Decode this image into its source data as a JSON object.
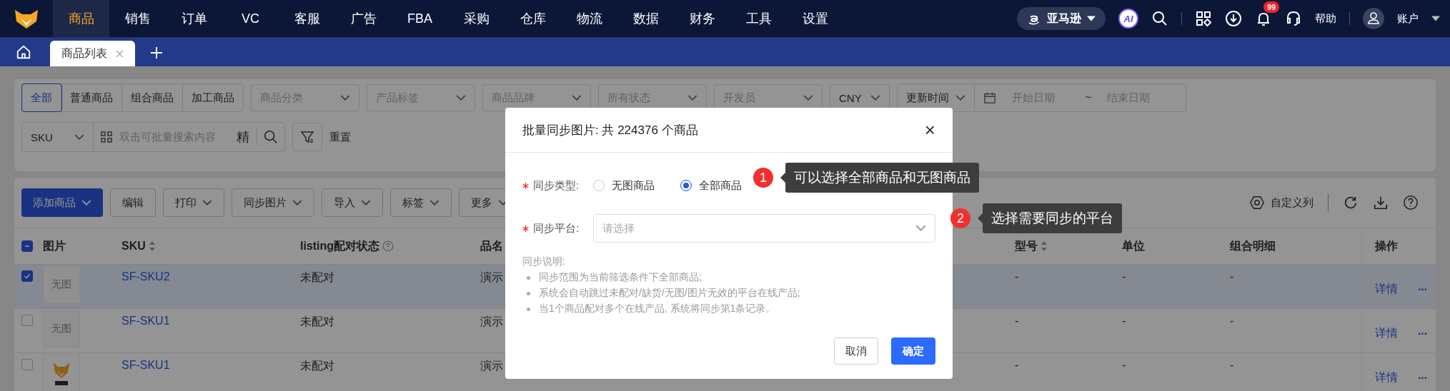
{
  "nav": {
    "items": [
      {
        "label": "商品",
        "selected": true
      },
      {
        "label": "销售",
        "selected": false
      },
      {
        "label": "订单",
        "selected": false
      },
      {
        "label": "VC",
        "selected": false
      },
      {
        "label": "客服",
        "selected": false
      },
      {
        "label": "广告",
        "selected": false
      },
      {
        "label": "FBA",
        "selected": false
      },
      {
        "label": "采购",
        "selected": false
      },
      {
        "label": "仓库",
        "selected": false
      },
      {
        "label": "物流",
        "selected": false
      },
      {
        "label": "数据",
        "selected": false
      },
      {
        "label": "财务",
        "selected": false
      },
      {
        "label": "工具",
        "selected": false
      },
      {
        "label": "设置",
        "selected": false
      }
    ],
    "platform": "亚马逊",
    "ai": "AI",
    "notifications": "99",
    "help": "帮助",
    "account": "账户"
  },
  "tabs": [
    {
      "label": "商品列表",
      "selected": true
    }
  ],
  "filters": {
    "segments": [
      {
        "label": "全部",
        "selected": true
      },
      {
        "label": "普通商品",
        "selected": false
      },
      {
        "label": "组合商品",
        "selected": false
      },
      {
        "label": "加工商品",
        "selected": false
      }
    ],
    "selects": [
      {
        "placeholder": "商品分类"
      },
      {
        "placeholder": "产品标签"
      },
      {
        "placeholder": "商品品牌"
      },
      {
        "placeholder": "所有状态"
      },
      {
        "placeholder": "开发员"
      }
    ],
    "currency": "CNY",
    "date_field": "更新时间",
    "start_placeholder": "开始日期",
    "range_sep": "~",
    "end_placeholder": "结束日期",
    "search_field": "SKU",
    "search_placeholder": "双击可批量搜索内容",
    "exact": "精",
    "reset": "重置"
  },
  "toolbar": {
    "buttons": [
      {
        "label": "添加商品",
        "kind": "primary",
        "dropdown": true
      },
      {
        "label": "编辑",
        "kind": "plain",
        "dropdown": false
      },
      {
        "label": "打印",
        "kind": "plain",
        "dropdown": true
      },
      {
        "label": "同步图片",
        "kind": "plain",
        "dropdown": true
      },
      {
        "label": "导入",
        "kind": "plain",
        "dropdown": true
      },
      {
        "label": "标签",
        "kind": "plain",
        "dropdown": true
      },
      {
        "label": "更多",
        "kind": "plain",
        "dropdown": true
      }
    ],
    "columns_button": "自定义列"
  },
  "table": {
    "all_indeterminate": true,
    "columns": [
      {
        "label": "图片",
        "sortable": false,
        "help": false
      },
      {
        "label": "SKU",
        "sortable": true,
        "help": false
      },
      {
        "label": "listing配对状态",
        "sortable": false,
        "help": true
      },
      {
        "label": "品名"
      },
      {
        "label": "型号",
        "sortable": true,
        "help": false
      },
      {
        "label": "单位",
        "sortable": false,
        "help": false
      },
      {
        "label": "组合明细",
        "sortable": false,
        "help": false
      },
      {
        "label": "操作",
        "sortable": false,
        "help": false
      }
    ],
    "rows": [
      {
        "checked": true,
        "image": {
          "kind": "none",
          "text": "无图"
        },
        "sku": "SF-SKU2",
        "status": "未配对",
        "name": "演示",
        "model": "-",
        "unit": "-",
        "combo": "-",
        "action": "详情",
        "more": "···"
      },
      {
        "checked": false,
        "image": {
          "kind": "none",
          "text": "无图"
        },
        "sku": "SF-SKU1",
        "status": "未配对",
        "name": "演示",
        "model": "-",
        "unit": "-",
        "combo": "-",
        "action": "详情",
        "more": "···"
      },
      {
        "checked": false,
        "sku": "SF-SKU1",
        "status": "未配对",
        "name": "演示",
        "model": "-",
        "unit": "-",
        "combo": "-",
        "action": "详情",
        "more": "···"
      }
    ]
  },
  "dialog": {
    "title": "批量同步图片: 共 224376 个商品",
    "close": "×",
    "type_label": "同步类型:",
    "options": [
      {
        "label": "无图商品",
        "selected": false
      },
      {
        "label": "全部商品",
        "selected": true
      }
    ],
    "platform_label": "同步平台:",
    "platform_placeholder": "请选择",
    "notes_title": "同步说明:",
    "notes": [
      "同步范围为当前筛选条件下全部商品;",
      "系统会自动跳过未配对/缺货/无图/图片无效的平台在线产品;",
      "当1个商品配对多个在线产品, 系统将同步第1条记录。"
    ],
    "cancel": "取消",
    "ok": "确定"
  },
  "callouts": [
    {
      "number": "1",
      "text": "可以选择全部商品和无图商品"
    },
    {
      "number": "2",
      "text": "选择需要同步的平台"
    }
  ]
}
